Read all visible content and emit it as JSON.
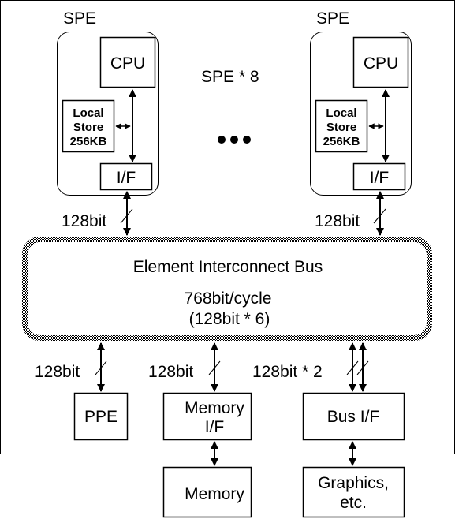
{
  "spe_left": {
    "title": "SPE",
    "cpu": "CPU",
    "local_store": [
      "Local",
      "Store",
      "256KB"
    ],
    "if": "I/F",
    "link": "128bit"
  },
  "spe_right": {
    "title": "SPE",
    "cpu": "CPU",
    "local_store": [
      "Local",
      "Store",
      "256KB"
    ],
    "if": "I/F",
    "link": "128bit"
  },
  "spe_count": "SPE * 8",
  "ellipsis": "•••",
  "eib": {
    "title": "Element Interconnect Bus",
    "bandwidth": "768bit/cycle",
    "detail": "(128bit * 6)"
  },
  "links": {
    "ppe": "128bit",
    "memory_if": "128bit",
    "bus_if": "128bit * 2"
  },
  "ppe": "PPE",
  "memory_if": [
    "Memory",
    "I/F"
  ],
  "bus_if": "Bus I/F",
  "memory": "Memory",
  "graphics": [
    "Graphics,",
    "etc."
  ]
}
